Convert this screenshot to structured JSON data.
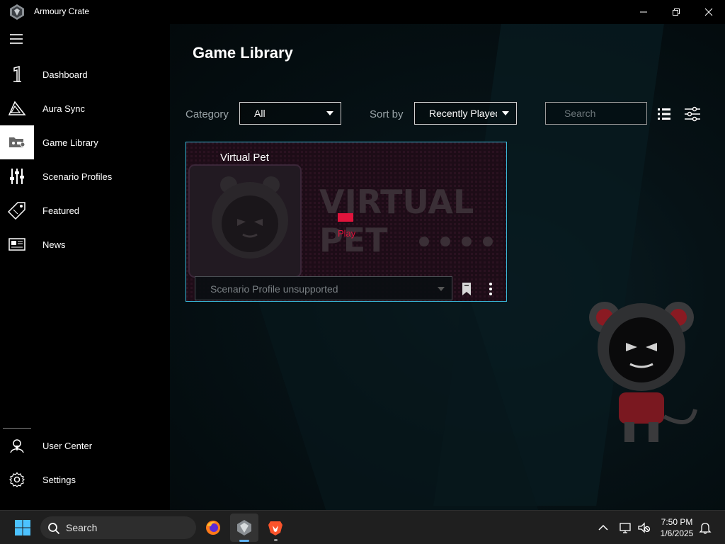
{
  "app": {
    "title": "Armoury Crate"
  },
  "window_controls": {
    "minimize": "—",
    "maximize": "❐",
    "close": "✕"
  },
  "sidebar": {
    "items": [
      {
        "label": "Dashboard",
        "icon": "dashboard-icon"
      },
      {
        "label": "Aura Sync",
        "icon": "aura-sync-icon"
      },
      {
        "label": "Game Library",
        "icon": "game-library-icon",
        "active": true
      },
      {
        "label": "Scenario Profiles",
        "icon": "scenario-profiles-icon"
      },
      {
        "label": "Featured",
        "icon": "featured-tag-icon"
      },
      {
        "label": "News",
        "icon": "news-icon"
      }
    ],
    "bottom_items": [
      {
        "label": "User Center",
        "icon": "user-center-icon"
      },
      {
        "label": "Settings",
        "icon": "gear-icon"
      }
    ]
  },
  "main": {
    "title": "Game Library",
    "filters": {
      "category_label": "Category",
      "category_value": "All",
      "sort_label": "Sort by",
      "sort_value": "Recently Played",
      "search_placeholder": "Search"
    },
    "games": [
      {
        "title": "Virtual Pet",
        "play_label": "Play",
        "profile_status": "Scenario Profile unsupported"
      }
    ]
  },
  "taskbar": {
    "search_label": "Search",
    "time": "7:50 PM",
    "date": "1/6/2025"
  },
  "colors": {
    "accent": "#3ab7d8",
    "play_red": "#e0143c",
    "active_nav_bg": "#ffffff"
  }
}
